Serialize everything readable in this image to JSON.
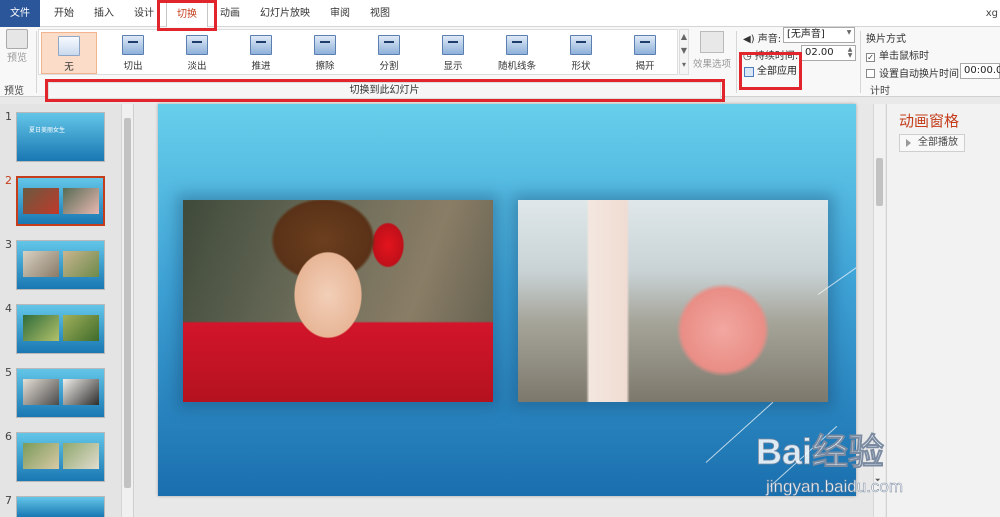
{
  "menu": {
    "file": "文件",
    "tabs": [
      "开始",
      "插入",
      "设计",
      "切换",
      "动画",
      "幻灯片放映",
      "审阅",
      "视图"
    ],
    "active_tab": "切换",
    "user": "xg"
  },
  "ribbon": {
    "preview": {
      "label": "预览",
      "group": "预览"
    },
    "transitions": [
      "无",
      "切出",
      "淡出",
      "推进",
      "擦除",
      "分割",
      "显示",
      "随机线条",
      "形状",
      "揭开"
    ],
    "selected_transition": "无",
    "effect_options": "效果选项",
    "apply_to_slide": "切换到此幻灯片",
    "timing": {
      "sound_label": "声音:",
      "sound_value": "[无声音]",
      "duration_label": "持续时间:",
      "duration_value": "02.00",
      "apply_all": "全部应用",
      "group": "计时"
    },
    "advance": {
      "title": "换片方式",
      "on_click": "单击鼠标时",
      "after_time": "设置自动换片时间:",
      "after_value": "00:00.0"
    }
  },
  "thumbnails": {
    "numbers": [
      "1",
      "2",
      "3",
      "4",
      "5",
      "6",
      "7"
    ],
    "active": "2",
    "cover_title": "夏日美丽女生"
  },
  "animation_pane": {
    "title": "动画窗格",
    "play_all": "全部播放"
  },
  "watermark": {
    "brand": "Bai经验",
    "url": "jingyan.baidu.com"
  },
  "colors": {
    "accent": "#c43e1c",
    "highlight": "#e0262c",
    "ribbon_blue": "#2b579a"
  }
}
